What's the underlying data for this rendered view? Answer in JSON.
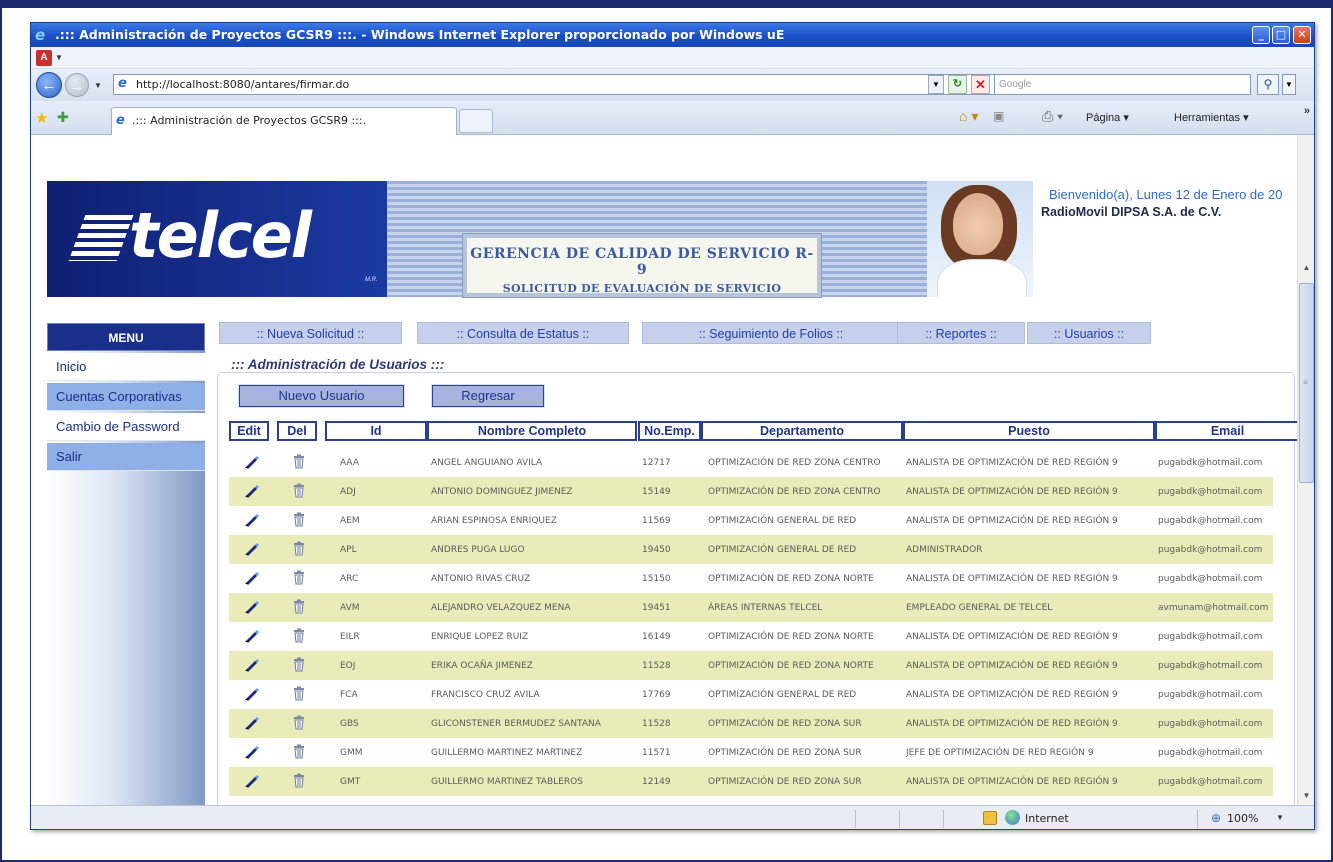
{
  "browser": {
    "window_title": ".::: Administración de Proyectos GCSR9 :::. - Windows Internet Explorer proporcionado por Windows uE",
    "address": "http://localhost:8080/antares/firmar.do",
    "search_placeholder": "Google",
    "tab_title": ".::: Administración de Proyectos GCSR9 :::.",
    "commands": {
      "page": "Página",
      "tools": "Herramientas",
      "more": "»"
    },
    "status": {
      "zone": "Internet",
      "zoom": "100%"
    }
  },
  "header": {
    "logo_text": "telcel",
    "logo_mark": "M.R.",
    "banner_line1": "GERENCIA DE CALIDAD DE SERVICIO R-9",
    "banner_line2": "SOLICITUD DE EVALUACIÓN DE SERVICIO",
    "welcome": "Bienvenido(a), Lunes 12 de Enero de 20",
    "company": "RadioMovil DIPSA S.A. de C.V."
  },
  "menu": {
    "title": "MENU",
    "items": [
      {
        "label": "Inicio"
      },
      {
        "label": "Cuentas Corporativas"
      },
      {
        "label": "Cambio de Password"
      },
      {
        "label": "Salir"
      }
    ]
  },
  "topnav": [
    {
      "label": ":: Nueva Solicitud ::"
    },
    {
      "label": ":: Consulta de Estatus ::"
    },
    {
      "label": ":: Seguimiento de Folios ::"
    },
    {
      "label": ":: Reportes ::"
    },
    {
      "label": ":: Usuarios ::"
    }
  ],
  "panel": {
    "legend": "::: Administración de Usuarios :::",
    "new_user_button": "Nuevo Usuario",
    "back_button": "Regresar"
  },
  "table": {
    "columns": [
      "Edit",
      "Del",
      "Id",
      "Nombre Completo",
      "No.Emp.",
      "Departamento",
      "Puesto",
      "Email"
    ],
    "rows": [
      {
        "id": "AAA",
        "name": "ANGEL ANGUIANO AVILA",
        "emp": "12717",
        "dept": "OPTIMIZACIÓN DE RED ZONA CENTRO",
        "puesto": "ANALISTA DE OPTIMIZACIÓN DE RED REGIÓN 9",
        "email": "pugabdk@hotmail.com"
      },
      {
        "id": "ADJ",
        "name": "ANTONIO DOMINGUEZ JIMENEZ",
        "emp": "15149",
        "dept": "OPTIMIZACIÓN DE RED ZONA CENTRO",
        "puesto": "ANALISTA DE OPTIMIZACIÓN DE RED REGIÓN 9",
        "email": "pugabdk@hotmail.com"
      },
      {
        "id": "AEM",
        "name": "ARIAN ESPINOSA ENRIQUEZ",
        "emp": "11569",
        "dept": "OPTIMIZACIÓN GENERAL DE RED",
        "puesto": "ANALISTA DE OPTIMIZACIÓN DE RED REGIÓN 9",
        "email": "pugabdk@hotmail.com"
      },
      {
        "id": "APL",
        "name": "ANDRES PUGA LUGO",
        "emp": "19450",
        "dept": "OPTIMIZACIÓN GENERAL DE RED",
        "puesto": "ADMINISTRADOR",
        "email": "pugabdk@hotmail.com"
      },
      {
        "id": "ARC",
        "name": "ANTONIO RIVAS CRUZ",
        "emp": "15150",
        "dept": "OPTIMIZACIÓN DE RED ZONA NORTE",
        "puesto": "ANALISTA DE OPTIMIZACIÓN DE RED REGIÓN 9",
        "email": "pugabdk@hotmail.com"
      },
      {
        "id": "AVM",
        "name": "ALEJANDRO VELAZQUEZ MENA",
        "emp": "19451",
        "dept": "ÁREAS INTERNAS TELCEL",
        "puesto": "EMPLEADO GENERAL DE TELCEL",
        "email": "avmunam@hotmail.com"
      },
      {
        "id": "EILR",
        "name": "ENRIQUE LOPEZ RUIZ",
        "emp": "16149",
        "dept": "OPTIMIZACIÓN DE RED ZONA NORTE",
        "puesto": "ANALISTA DE OPTIMIZACIÓN DE RED REGIÓN 9",
        "email": "pugabdk@hotmail.com"
      },
      {
        "id": "EOJ",
        "name": "ERIKA OCAÑA JIMENEZ",
        "emp": "11528",
        "dept": "OPTIMIZACIÓN DE RED ZONA NORTE",
        "puesto": "ANALISTA DE OPTIMIZACIÓN DE RED REGIÓN 9",
        "email": "pugabdk@hotmail.com"
      },
      {
        "id": "FCA",
        "name": "FRANCISCO CRUZ AVILA",
        "emp": "17769",
        "dept": "OPTIMIZACIÓN GENERAL DE RED",
        "puesto": "ANALISTA DE OPTIMIZACIÓN DE RED REGIÓN 9",
        "email": "pugabdk@hotmail.com"
      },
      {
        "id": "GBS",
        "name": "GLICONSTENER BERMUDEZ SANTANA",
        "emp": "11528",
        "dept": "OPTIMIZACIÓN DE RED ZONA SUR",
        "puesto": "ANALISTA DE OPTIMIZACIÓN DE RED REGIÓN 9",
        "email": "pugabdk@hotmail.com"
      },
      {
        "id": "GMM",
        "name": "GUILLERMO MARTINEZ MARTINEZ",
        "emp": "11571",
        "dept": "OPTIMIZACIÓN DE RED ZONA SUR",
        "puesto": "JEFE DE OPTIMIZACIÓN DE RED REGIÓN 9",
        "email": "pugabdk@hotmail.com"
      },
      {
        "id": "GMT",
        "name": "GUILLERMO MARTINEZ TABLEROS",
        "emp": "12149",
        "dept": "OPTIMIZACIÓN DE RED ZONA SUR",
        "puesto": "ANALISTA DE OPTIMIZACIÓN DE RED REGIÓN 9",
        "email": "pugabdk@hotmail.com"
      }
    ]
  },
  "colors": {
    "title_bar": "#1a4fc7",
    "menu_header": "#1a2f8a",
    "row_alt": "#e9ecb8",
    "link_blue": "#1f3491"
  },
  "icons": {
    "edit": "pencil-icon",
    "delete": "trash-icon",
    "browser": "ie-icon"
  }
}
